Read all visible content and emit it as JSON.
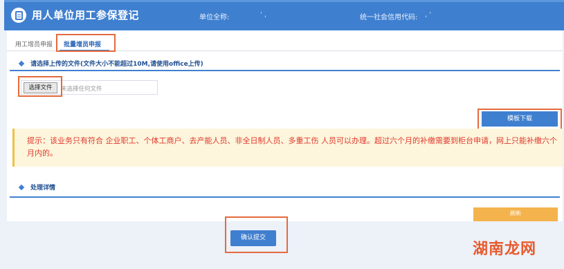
{
  "header": {
    "title": "用人单位用工参保登记",
    "unit_name_label": "单位全称:",
    "unit_name_value": "'       ,",
    "credit_code_label": "统一社会信用代码:",
    "credit_code_value": ",      '"
  },
  "tabs": [
    {
      "label": "用工增员申报"
    },
    {
      "label": "批量增员申报"
    }
  ],
  "upload": {
    "section_title": "请选择上传的文件(文件大小不能超过10M,请使用office上传)",
    "choose_file_label": "选择文件",
    "no_file_label": "未选择任何文件"
  },
  "template_download_label": "模板下载",
  "notice": {
    "text": "提示：该业务只有符合 企业职工、个体工商户、去产能人员、非全日制人员、多重工伤 人员可以办理。超过六个月的补缴需要到柜台申请，网上只能补缴六个月内的。"
  },
  "details": {
    "section_title": "处理详情",
    "refresh_label": "刷新"
  },
  "submit_label": "确认提交",
  "watermark": "湖南龙网",
  "colors": {
    "header_blue": "#3f7fd0",
    "highlight_orange": "#e46a3c",
    "notice_red": "#e03a2e",
    "notice_bg": "#fdf5dc",
    "refresh_orange": "#f4b34c"
  }
}
